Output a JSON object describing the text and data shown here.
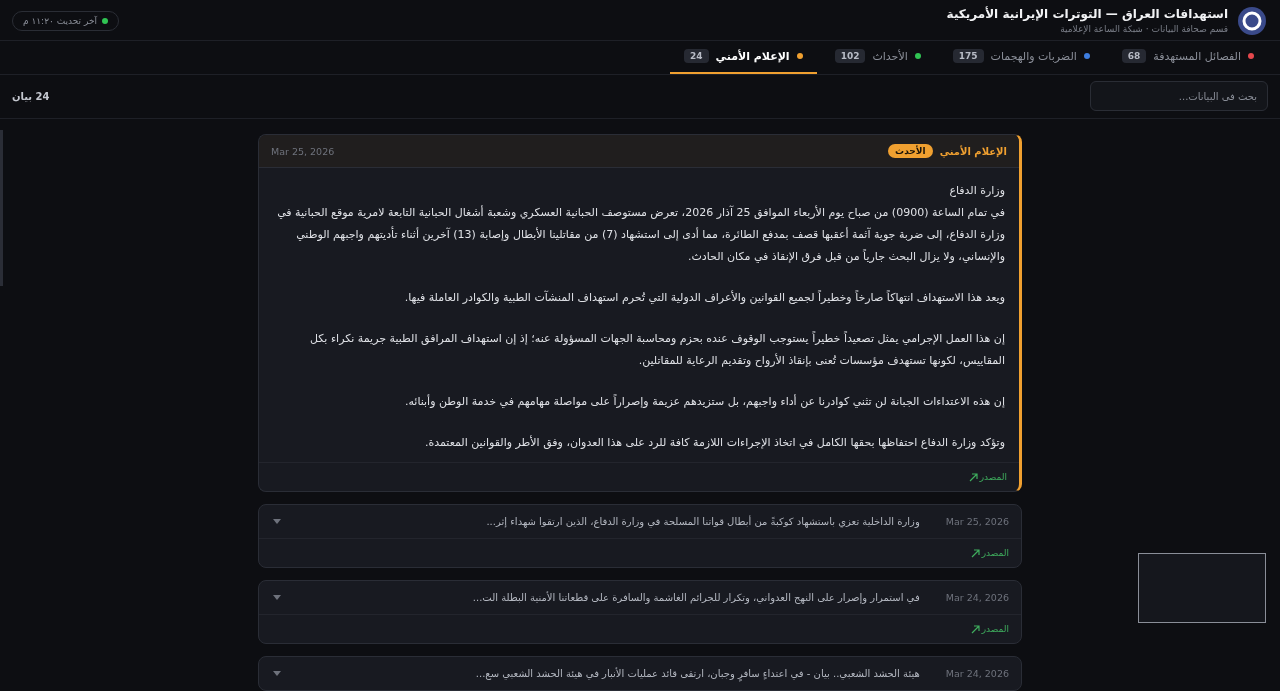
{
  "header": {
    "title": "استهدافات العراق — التوترات الإيرانية الأمريكية",
    "subtitle": "قسم صحافة البيانات · شبكة الساعة الإعلامية",
    "last_update": "آخر تحديث ١١:٢٠ م"
  },
  "tabs": [
    {
      "label": "الفصائل المستهدفة",
      "count": "68",
      "color": "#e5484d",
      "selected": false
    },
    {
      "label": "الضربات والهجمات",
      "count": "175",
      "color": "#3e7ee0",
      "selected": false
    },
    {
      "label": "الأحداث",
      "count": "102",
      "color": "#30c453",
      "selected": false
    },
    {
      "label": "الإعلام الأمني",
      "count": "24",
      "color": "#f0a030",
      "selected": true
    }
  ],
  "search": {
    "placeholder": "بحث في البيانات..."
  },
  "count": "24 بيان",
  "items": [
    {
      "expanded": true,
      "category": "الإعلام الأمني",
      "badge": "الأحدث",
      "date": "Mar 25, 2026",
      "paragraphs": [
        [
          "وزارة الدفاع",
          "في تمام الساعة (0900) من صباح يوم الأربعاء الموافق 25 آذار 2026، تعرض مستوصف الحبانية العسكري وشعبة أشغال الحبانية التابعة لامرية موقع الحبانية في وزارة الدفاع، إلى ضربة جوية آثمة أعقبها قصف بمدفع الطائرة، مما أدى إلى استشهاد (7) من مقاتلينا الأبطال وإصابة (13) آخرين أثناء تأديتهم واجبهم الوطني والإنساني، ولا يزال البحث جارياً من قبل فرق الإنقاذ في مكان الحادث."
        ],
        [
          "ويعد هذا الاستهداف انتهاكاً صارخاً وخطيراً لجميع القوانين والأعراف الدولية التي تُحرم استهداف المنشآت الطبية والكوادر العاملة فيها."
        ],
        [
          "إن هذا العمل الإجرامي يمثل تصعيداً خطيراً يستوجب الوقوف عنده بحزم ومحاسبة الجهات المسؤولة عنه؛ إذ إن استهداف المرافق الطبية جريمة نكراء بكل المقاييس، لكونها تستهدف مؤسسات تُعنى بإنقاذ الأرواح وتقديم الرعاية للمقاتلين."
        ],
        [
          "إن هذه الاعتداءات الجبانة لن تثني كوادرنا عن أداء واجبهم، بل ستزيدهم عزيمة وإصراراً على مواصلة مهامهم في خدمة الوطن وأبنائه."
        ],
        [
          "وتؤكد وزارة الدفاع احتفاظها بحقها الكامل في اتخاذ الإجراءات اللازمة كافة للرد على هذا العدوان، وفق الأطر والقوانين المعتمدة."
        ]
      ],
      "source": "المصدر"
    },
    {
      "expanded": false,
      "date": "Mar 25, 2026",
      "summary": "وزارة الداخلية تعزي باستشهاد كوكبةً من أبطال قواتنا المسلحة في وزارة الدفاع، الذين ارتقوا شهداء إثر...",
      "source": "المصدر"
    },
    {
      "expanded": false,
      "date": "Mar 24, 2026",
      "summary": "في استمرار وإصرار على النهج العدواني، وتكرار للجرائم الغاشمة والسافرة على قطعاتنا الأمنية البطلة الت...",
      "source": "المصدر"
    },
    {
      "expanded": false,
      "date": "Mar 24, 2026",
      "summary": "هيئة الحشد الشعبي.. بيان - في اعتداءٍ سافرٍ وجبان، ارتقى قائد عمليات الأنبار في هيئة الحشد الشعبي سع..."
    }
  ]
}
